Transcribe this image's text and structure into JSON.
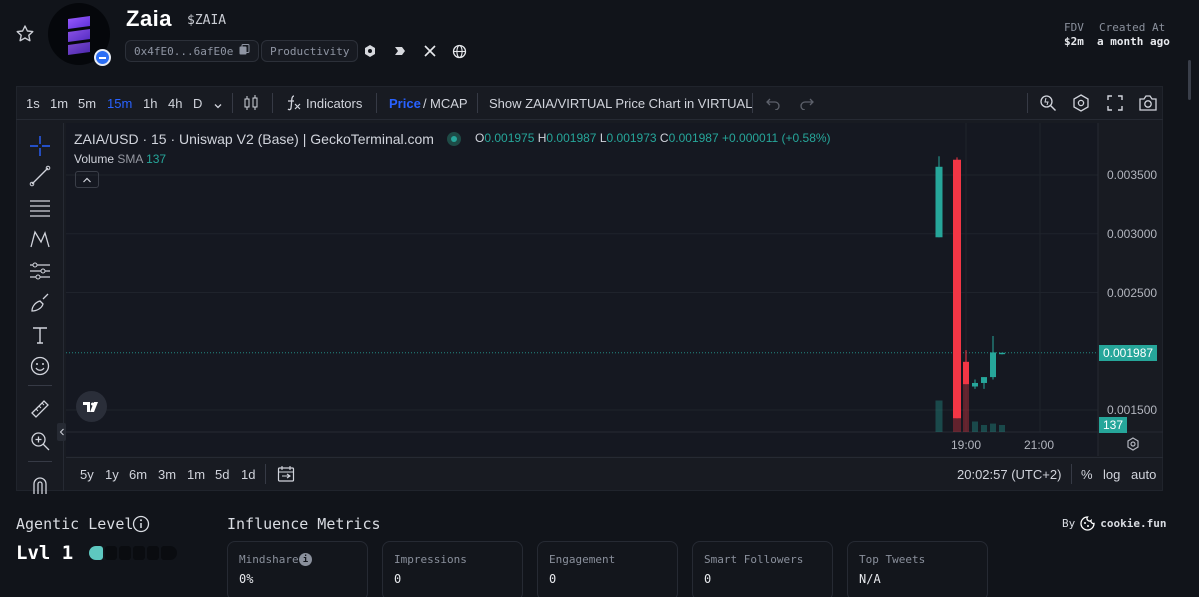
{
  "token": {
    "name": "Zaia",
    "ticker": "$ZAIA",
    "address": "0x4fE0...6afE0e",
    "category": "Productivity",
    "fdv_label": "FDV",
    "fdv_value": "$2m",
    "created_label": "Created At",
    "created_value": "a month ago"
  },
  "toolbar": {
    "timeframes": [
      "1s",
      "1m",
      "5m",
      "15m",
      "1h",
      "4h",
      "D"
    ],
    "active_timeframe": "15m",
    "indicators_label": "Indicators",
    "price_label": "Price",
    "slash": "/",
    "mcap_label": "MCAP",
    "show_chart_label": "Show ZAIA/VIRTUAL Price Chart in VIRTUAL"
  },
  "legend": {
    "title": "ZAIA/USD · 15 · Uniswap V2 (Base) | GeckoTerminal.com",
    "o_label": "O",
    "o": "0.001975",
    "h_label": "H",
    "h": "0.001987",
    "l_label": "L",
    "l": "0.001973",
    "c_label": "C",
    "c": "0.001987",
    "change": "+0.000011 (+0.58%)",
    "volume_label": "Volume",
    "sma_label": "SMA",
    "volume_value": "137"
  },
  "price_scale": [
    "0.003500",
    "0.003000",
    "0.002500",
    "0.001500"
  ],
  "last_price": "0.001987",
  "last_volume": "137",
  "time_scale": [
    "19:00",
    "21:00"
  ],
  "ranges": [
    "5y",
    "1y",
    "6m",
    "3m",
    "1m",
    "5d",
    "1d"
  ],
  "clock": "20:02:57 (UTC+2)",
  "scale_opts": [
    "%",
    "log",
    "auto"
  ],
  "chart_data": {
    "type": "candlestick",
    "title": "ZAIA/USD · 15 · Uniswap V2 (Base) | GeckoTerminal.com",
    "x_ticks": [
      "19:00",
      "21:00"
    ],
    "y_ticks": [
      0.0015,
      0.0025,
      0.003,
      0.0035
    ],
    "candles": [
      {
        "o": 0.00297,
        "h": 0.00366,
        "l": 0.00297,
        "c": 0.00357,
        "dir": "up"
      },
      {
        "o": 0.00363,
        "h": 0.00365,
        "l": 0.00143,
        "c": 0.00143,
        "dir": "down"
      },
      {
        "o": 0.00191,
        "h": 0.00201,
        "l": 0.00172,
        "c": 0.00172,
        "dir": "down"
      },
      {
        "o": 0.0017,
        "h": 0.00176,
        "l": 0.00168,
        "c": 0.00173,
        "dir": "up"
      },
      {
        "o": 0.00173,
        "h": 0.00178,
        "l": 0.00168,
        "c": 0.00178,
        "dir": "up"
      },
      {
        "o": 0.00178,
        "h": 0.00213,
        "l": 0.00176,
        "c": 0.00199,
        "dir": "up"
      },
      {
        "o": 0.001975,
        "h": 0.001987,
        "l": 0.001973,
        "c": 0.001987,
        "dir": "up"
      }
    ],
    "volume_sma": 137,
    "colors": {
      "up": "#26a69a",
      "down": "#f23645"
    }
  },
  "agentic": {
    "title": "Agentic Level",
    "level": "Lvl 1",
    "filled": 1,
    "total": 6
  },
  "influence": {
    "title": "Influence Metrics",
    "by_label": "By",
    "provider": "cookie.fun",
    "metrics": [
      {
        "label": "Mindshare",
        "value": "0%"
      },
      {
        "label": "Impressions",
        "value": "0"
      },
      {
        "label": "Engagement",
        "value": "0"
      },
      {
        "label": "Smart Followers",
        "value": "0"
      },
      {
        "label": "Top Tweets",
        "value": "N/A"
      }
    ]
  },
  "colors": {
    "accent": "#2962ff",
    "up": "#26a69a",
    "down": "#f23645",
    "bg": "#11141a"
  }
}
